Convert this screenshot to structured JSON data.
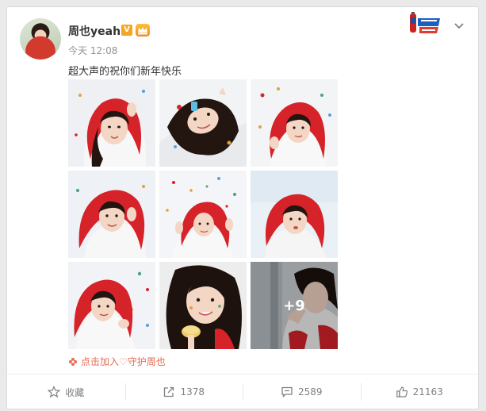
{
  "post": {
    "username": "周也yeah",
    "verified_badge": "V",
    "level_badge": "VIP",
    "time": "今天 12:08",
    "text": "超大声的祝你们新年快乐",
    "more_photos": "+9",
    "fan_join": "点击加入♡守护周也"
  },
  "actions": {
    "favorite_label": "收藏",
    "repost_count": "1378",
    "comment_count": "2589",
    "like_count": "21163"
  },
  "icons": {
    "chevron": "chevron-down-icon",
    "favorite": "star-icon",
    "repost": "share-icon",
    "comment": "comment-icon",
    "like": "thumbs-up-icon"
  },
  "colors": {
    "hood_red": "#d6232a",
    "verified_orange": "#f5a623",
    "fan_link": "#e86a4e"
  }
}
